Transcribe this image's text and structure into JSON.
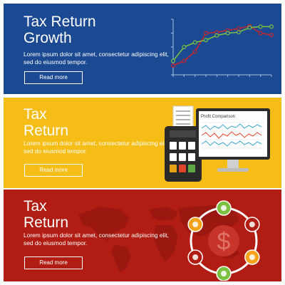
{
  "banners": [
    {
      "title": "Tax Return\nGrowth",
      "body": "Lorem ipsum dolor sit amet, consectetur adipiscing elit, sed do eiusmod tempor.",
      "button": "Read more",
      "background": "#1b4a93",
      "chart_data": {
        "type": "line",
        "series": [
          {
            "color": "#c8252c",
            "values": [
              2,
              3,
              5,
              9,
              9.2,
              9.6,
              10,
              10.5,
              9,
              8.6
            ]
          },
          {
            "color": "#7cc242",
            "values": [
              3,
              6,
              7,
              7.5,
              8.5,
              9,
              9.2,
              10.2,
              10.4,
              10.4
            ]
          }
        ],
        "ylim": [
          0,
          12
        ],
        "grid": false
      }
    },
    {
      "title": "Tax\nReturn",
      "body": "Lorem ipsum dolor sit amet, consectetur adipiscing elit, sed do eiusmod tempor.",
      "button": "Read more",
      "background": "#f6bd16",
      "monitor_title": "Profit Comparison",
      "calculator_keys": [
        "#ffffff",
        "#ffffff",
        "#ffffff",
        "#ffffff",
        "#ffffff",
        "#ffffff",
        "#e8a21a",
        "#e0442c",
        "#5ea845"
      ]
    },
    {
      "title": "Tax\nReturn",
      "body": "Lorem ipsum dolor sit amet, consectetur adipiscing elit, sed do eiusmod tempor.",
      "button": "Read more",
      "background": "#b11d13",
      "center_symbol": "$",
      "ring_icons": [
        {
          "name": "user-icon",
          "color": "#7cc242"
        },
        {
          "name": "bank-icon",
          "color": "#b11d13"
        },
        {
          "name": "dollar-coin-icon",
          "color": "#f6a31b"
        },
        {
          "name": "document-icon",
          "color": "#7cc242"
        },
        {
          "name": "people-icon",
          "color": "#b11d13"
        },
        {
          "name": "target-icon",
          "color": "#f6a31b"
        }
      ]
    }
  ]
}
